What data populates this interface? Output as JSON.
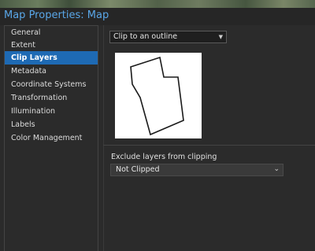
{
  "window": {
    "title": "Map Properties: Map"
  },
  "sidebar": {
    "items": [
      {
        "label": "General"
      },
      {
        "label": "Extent"
      },
      {
        "label": "Clip Layers",
        "selected": true
      },
      {
        "label": "Metadata"
      },
      {
        "label": "Coordinate Systems"
      },
      {
        "label": "Transformation"
      },
      {
        "label": "Illumination"
      },
      {
        "label": "Labels"
      },
      {
        "label": "Color Management"
      }
    ]
  },
  "clip": {
    "mode_selected": "Clip to an outline",
    "dropdown_arrow_icon": "triangle-down-icon"
  },
  "exclude": {
    "label": "Exclude layers from clipping",
    "value": "Not Clipped",
    "chevron_icon": "chevron-down-icon"
  },
  "colors": {
    "accent": "#1e6ab4",
    "title": "#5aa7e8",
    "background": "#2b2b2b"
  }
}
